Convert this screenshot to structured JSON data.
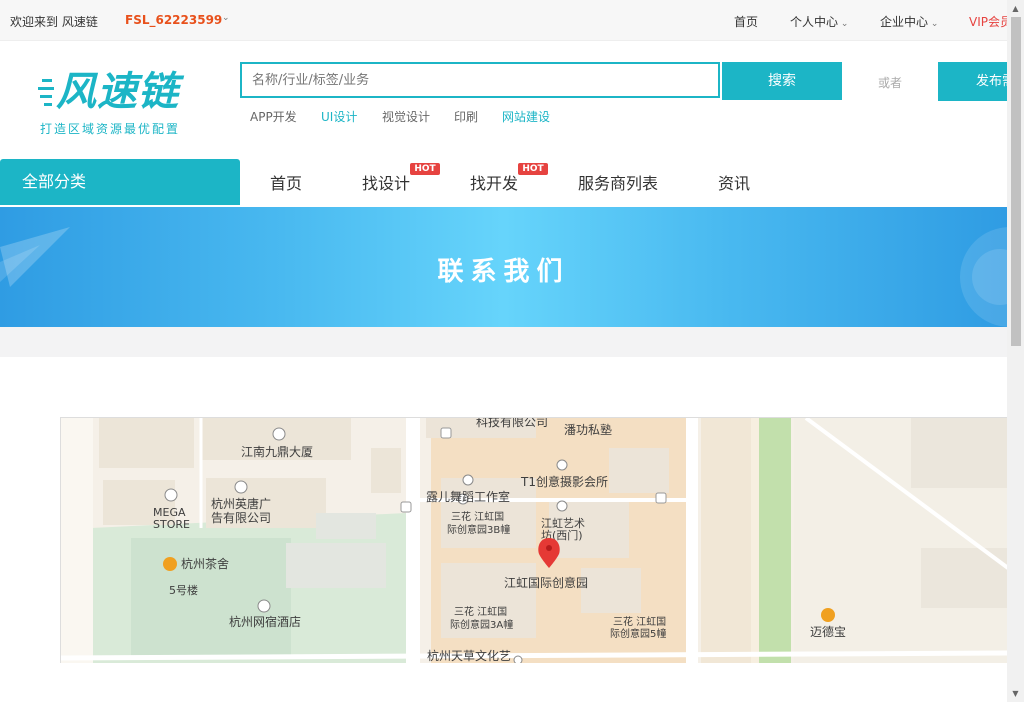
{
  "topbar": {
    "welcome": "欢迎来到 风速链",
    "username": "FSL_62223599",
    "links": [
      "首页",
      "个人中心",
      "企业中心",
      "VIP会员"
    ]
  },
  "logo": {
    "name": "风速链",
    "slogan": "打造区域资源最优配置"
  },
  "search": {
    "placeholder": "名称/行业/标签/业务",
    "button": "搜索",
    "or": "或者",
    "publish": "发布需求"
  },
  "hot_words": [
    "APP开发",
    "UI设计",
    "视觉设计",
    "印刷",
    "网站建设"
  ],
  "nav": {
    "all": "全部分类",
    "items": [
      "首页",
      "找设计",
      "找开发",
      "服务商列表",
      "资讯"
    ],
    "hot_label": "HOT"
  },
  "banner": {
    "title": "联系我们"
  },
  "map": {
    "labels": {
      "l1": "科技有限公司",
      "l2": "潘功私塾",
      "l3": "江南九鼎大厦",
      "l4": "T1创意摄影会所",
      "l5": "露儿舞蹈工作室",
      "l6a": "MEGA",
      "l6b": "STORE",
      "l7a": "杭州英唐广",
      "l7b": "告有限公司",
      "l8a": "三花 江虹国",
      "l8b": "际创意园3B幢",
      "l9a": "江虹艺术",
      "l9b": "坊(西门)",
      "l10": "杭州茶舍",
      "l11": "江虹国际创意园",
      "l12": "5号楼",
      "l13": "杭州网宿酒店",
      "l14a": "三花 江虹国",
      "l14b": "际创意园3A幢",
      "l15a": "三花 江虹国",
      "l15b": "际创意园5幢",
      "l16": "迈德宝",
      "l17": "杭州天草文化艺"
    }
  }
}
